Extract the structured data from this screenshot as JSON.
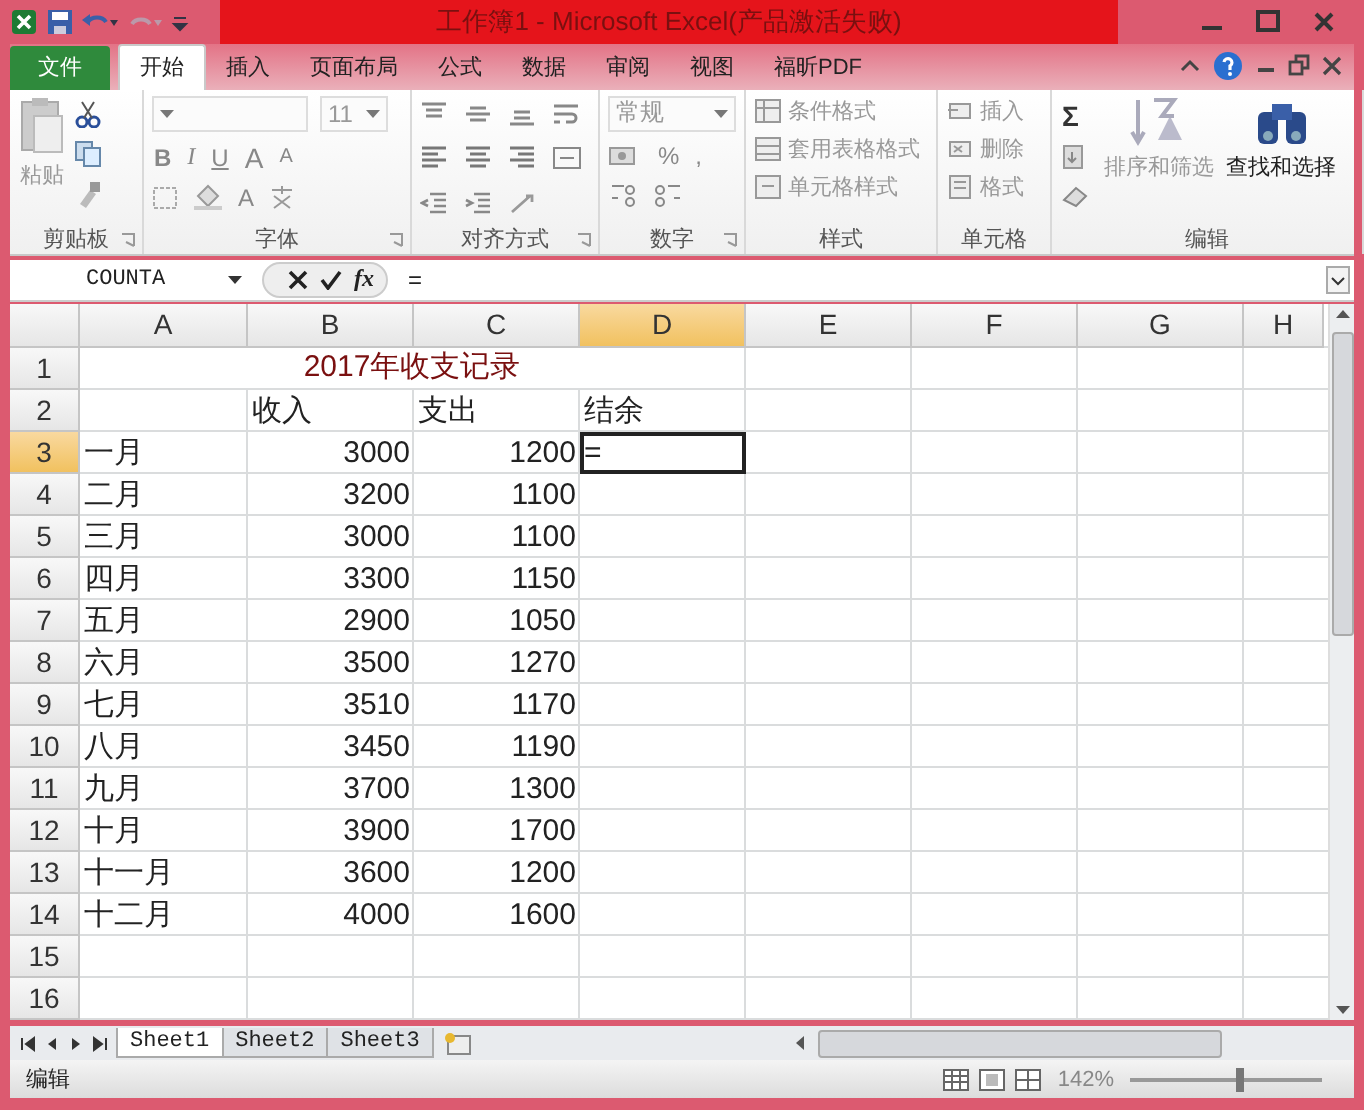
{
  "window": {
    "title": "工作簿1 - Microsoft Excel(产品激活失败)"
  },
  "tabs": [
    {
      "label": "文件",
      "kind": "file",
      "selected": false
    },
    {
      "label": "开始",
      "kind": "tab",
      "selected": true
    },
    {
      "label": "插入",
      "kind": "tab",
      "selected": false
    },
    {
      "label": "页面布局",
      "kind": "tab",
      "selected": false
    },
    {
      "label": "公式",
      "kind": "tab",
      "selected": false
    },
    {
      "label": "数据",
      "kind": "tab",
      "selected": false
    },
    {
      "label": "审阅",
      "kind": "tab",
      "selected": false
    },
    {
      "label": "视图",
      "kind": "tab",
      "selected": false
    },
    {
      "label": "福昕PDF",
      "kind": "tab",
      "selected": false
    }
  ],
  "ribbon": {
    "clipboard": {
      "label": "剪贴板",
      "paste": "粘贴"
    },
    "font": {
      "label": "字体",
      "size": "11",
      "bold": "B",
      "italic": "I",
      "underline": "U",
      "grow": "A",
      "shrink": "A",
      "font_color": "A"
    },
    "alignment": {
      "label": "对齐方式"
    },
    "number": {
      "label": "数字",
      "format": "常规",
      "percent": "%",
      "comma": ","
    },
    "styles": {
      "label": "样式",
      "conditional": "条件格式",
      "table": "套用表格格式",
      "cell_styles": "单元格样式"
    },
    "cells": {
      "label": "单元格",
      "insert": "插入",
      "delete": "删除",
      "format": "格式"
    },
    "editing": {
      "label": "编辑",
      "sum": "Σ",
      "sort": "排序和筛选",
      "find": "查找和选择"
    }
  },
  "formula_bar": {
    "name_box": "COUNTA",
    "fx": "fx",
    "value": "="
  },
  "columns": [
    {
      "label": "A",
      "selected": false
    },
    {
      "label": "B",
      "selected": false
    },
    {
      "label": "C",
      "selected": false
    },
    {
      "label": "D",
      "selected": true
    },
    {
      "label": "E",
      "selected": false
    },
    {
      "label": "F",
      "selected": false
    },
    {
      "label": "G",
      "selected": false
    },
    {
      "label": "H",
      "selected": false
    }
  ],
  "rows": [
    {
      "label": "1",
      "kind": "title",
      "selected": false,
      "title": "2017年收支记录"
    },
    {
      "label": "2",
      "kind": "header",
      "selected": false,
      "B": "收入",
      "C": "支出",
      "D": "结余"
    },
    {
      "label": "3",
      "kind": "data",
      "selected": true,
      "A": "一月",
      "B": "3000",
      "C": "1200",
      "D": "="
    },
    {
      "label": "4",
      "kind": "data",
      "selected": false,
      "A": "二月",
      "B": "3200",
      "C": "1100"
    },
    {
      "label": "5",
      "kind": "data",
      "selected": false,
      "A": "三月",
      "B": "3000",
      "C": "1100"
    },
    {
      "label": "6",
      "kind": "data",
      "selected": false,
      "A": "四月",
      "B": "3300",
      "C": "1150"
    },
    {
      "label": "7",
      "kind": "data",
      "selected": false,
      "A": "五月",
      "B": "2900",
      "C": "1050"
    },
    {
      "label": "8",
      "kind": "data",
      "selected": false,
      "A": "六月",
      "B": "3500",
      "C": "1270"
    },
    {
      "label": "9",
      "kind": "data",
      "selected": false,
      "A": "七月",
      "B": "3510",
      "C": "1170"
    },
    {
      "label": "10",
      "kind": "data",
      "selected": false,
      "A": "八月",
      "B": "3450",
      "C": "1190"
    },
    {
      "label": "11",
      "kind": "data",
      "selected": false,
      "A": "九月",
      "B": "3700",
      "C": "1300"
    },
    {
      "label": "12",
      "kind": "data",
      "selected": false,
      "A": "十月",
      "B": "3900",
      "C": "1700"
    },
    {
      "label": "13",
      "kind": "data",
      "selected": false,
      "A": "十一月",
      "B": "3600",
      "C": "1200"
    },
    {
      "label": "14",
      "kind": "data",
      "selected": false,
      "A": "十二月",
      "B": "4000",
      "C": "1600"
    },
    {
      "label": "15",
      "kind": "empty",
      "selected": false
    },
    {
      "label": "16",
      "kind": "empty",
      "selected": false
    }
  ],
  "sheets": [
    {
      "label": "Sheet1",
      "selected": true
    },
    {
      "label": "Sheet2",
      "selected": false
    },
    {
      "label": "Sheet3",
      "selected": false
    }
  ],
  "status_bar": {
    "mode": "编辑",
    "zoom": "142%",
    "zoom_slider": {
      "level": 0.57
    }
  }
}
